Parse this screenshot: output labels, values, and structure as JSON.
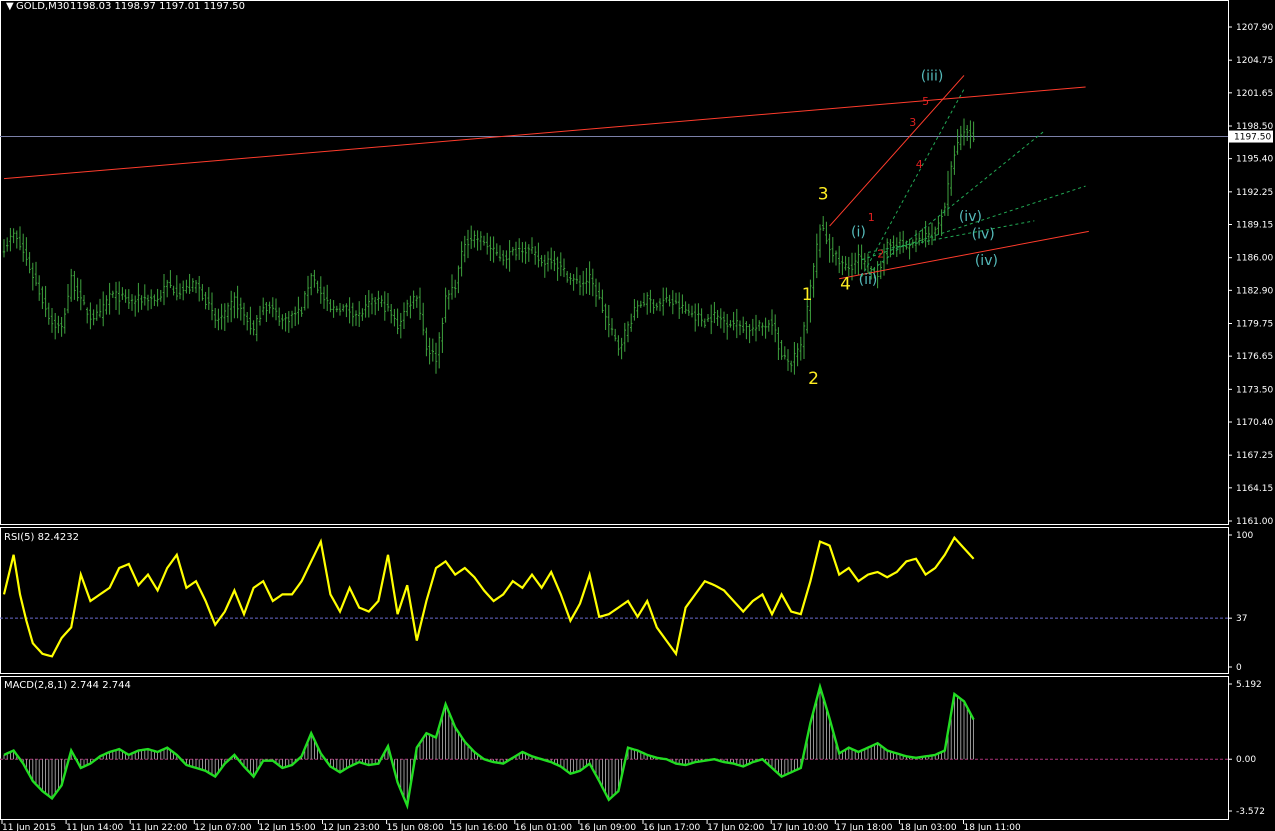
{
  "header": {
    "symbol": "GOLD,M30",
    "ohlc": "1198.03 1198.97 1197.01 1197.50",
    "rsi_label": "RSI(5) 82.4232",
    "macd_label": "MACD(2,8,1) 2.744 2.744"
  },
  "colors": {
    "background": "#000000",
    "candle": "#3fa33f",
    "rsi": "#ffff00",
    "macd": "#22dd22",
    "trendline": "#ff3c2c",
    "guide": "#22aa55",
    "price_line": "#7b80a8",
    "frame": "#ffffff"
  },
  "chart_data": [
    {
      "type": "candlestick",
      "name": "GOLD,M30",
      "ylim": [
        1160.0,
        1210.0
      ],
      "y_ticks": [
        "1207.90",
        "1204.75",
        "1201.65",
        "1198.50",
        "1195.40",
        "1192.25",
        "1189.15",
        "1186.00",
        "1182.90",
        "1179.75",
        "1176.65",
        "1173.50",
        "1170.40",
        "1167.25",
        "1164.15",
        "1161.00"
      ],
      "current_price": "1197.50",
      "x_ticks": [
        "11 Jun 2015",
        "11 Jun 14:00",
        "11 Jun 22:00",
        "12 Jun 07:00",
        "12 Jun 15:00",
        "12 Jun 23:00",
        "15 Jun 08:00",
        "15 Jun 16:00",
        "16 Jun 01:00",
        "16 Jun 09:00",
        "16 Jun 17:00",
        "17 Jun 02:00",
        "17 Jun 10:00",
        "17 Jun 18:00",
        "18 Jun 03:00",
        "18 Jun 11:00"
      ],
      "close_path": [
        [
          0,
          1187.0
        ],
        [
          3,
          1188.2
        ],
        [
          6,
          1186.5
        ],
        [
          9,
          1184.3
        ],
        [
          12,
          1182.0
        ],
        [
          15,
          1179.8
        ],
        [
          18,
          1179.3
        ],
        [
          21,
          1184.0
        ],
        [
          24,
          1181.8
        ],
        [
          27,
          1180.4
        ],
        [
          30,
          1180.5
        ],
        [
          33,
          1182.5
        ],
        [
          36,
          1182.3
        ],
        [
          39,
          1181.8
        ],
        [
          42,
          1182.0
        ],
        [
          45,
          1182.2
        ],
        [
          48,
          1182.0
        ],
        [
          51,
          1183.5
        ],
        [
          54,
          1182.8
        ],
        [
          57,
          1183.0
        ],
        [
          60,
          1183.5
        ],
        [
          63,
          1182.0
        ],
        [
          66,
          1180.0
        ],
        [
          69,
          1180.5
        ],
        [
          72,
          1182.0
        ],
        [
          75,
          1180.5
        ],
        [
          78,
          1179.0
        ],
        [
          81,
          1181.5
        ],
        [
          84,
          1181.0
        ],
        [
          87,
          1180.0
        ],
        [
          90,
          1180.5
        ],
        [
          93,
          1181.0
        ],
        [
          96,
          1184.5
        ],
        [
          99,
          1182.5
        ],
        [
          102,
          1181.0
        ],
        [
          105,
          1181.3
        ],
        [
          108,
          1181.0
        ],
        [
          111,
          1180.5
        ],
        [
          114,
          1181.5
        ],
        [
          117,
          1182.0
        ],
        [
          120,
          1181.0
        ],
        [
          123,
          1179.5
        ],
        [
          126,
          1181.5
        ],
        [
          129,
          1182.5
        ],
        [
          132,
          1177.5
        ],
        [
          135,
          1176.5
        ],
        [
          138,
          1182.0
        ],
        [
          141,
          1183.5
        ],
        [
          144,
          1187.5
        ],
        [
          147,
          1188.0
        ],
        [
          150,
          1187.5
        ],
        [
          153,
          1186.5
        ],
        [
          156,
          1186.0
        ],
        [
          159,
          1186.5
        ],
        [
          162,
          1187.0
        ],
        [
          165,
          1186.5
        ],
        [
          168,
          1185.5
        ],
        [
          171,
          1186.0
        ],
        [
          174,
          1185.0
        ],
        [
          177,
          1184.0
        ],
        [
          180,
          1183.5
        ],
        [
          183,
          1184.0
        ],
        [
          186,
          1182.0
        ],
        [
          189,
          1179.5
        ],
        [
          192,
          1177.5
        ],
        [
          195,
          1179.5
        ],
        [
          198,
          1181.5
        ],
        [
          201,
          1182.0
        ],
        [
          204,
          1181.5
        ],
        [
          207,
          1182.0
        ],
        [
          210,
          1181.5
        ],
        [
          213,
          1181.0
        ],
        [
          216,
          1180.5
        ],
        [
          219,
          1180.0
        ],
        [
          222,
          1180.5
        ],
        [
          225,
          1180.0
        ],
        [
          228,
          1179.8
        ],
        [
          231,
          1179.5
        ],
        [
          234,
          1179.2
        ],
        [
          237,
          1179.5
        ],
        [
          240,
          1180.0
        ],
        [
          243,
          1176.5
        ],
        [
          246,
          1176.0
        ],
        [
          249,
          1177.5
        ],
        [
          252,
          1183.0
        ],
        [
          255,
          1189.0
        ],
        [
          258,
          1187.0
        ],
        [
          261,
          1185.5
        ],
        [
          264,
          1185.0
        ],
        [
          267,
          1186.0
        ],
        [
          270,
          1185.0
        ],
        [
          273,
          1184.5
        ],
        [
          276,
          1187.0
        ],
        [
          279,
          1187.5
        ],
        [
          282,
          1187.0
        ],
        [
          285,
          1187.5
        ],
        [
          288,
          1188.0
        ],
        [
          291,
          1188.5
        ],
        [
          294,
          1191.0
        ],
        [
          297,
          1196.0
        ],
        [
          300,
          1198.0
        ],
        [
          303,
          1197.5
        ]
      ]
    },
    {
      "type": "line",
      "name": "RSI(5)",
      "ylim": [
        0,
        100
      ],
      "y_ticks": [
        "100",
        "37",
        "0"
      ],
      "level": 37,
      "points": [
        [
          0,
          55
        ],
        [
          3,
          85
        ],
        [
          5,
          55
        ],
        [
          7,
          35
        ],
        [
          9,
          18
        ],
        [
          12,
          10
        ],
        [
          15,
          8
        ],
        [
          18,
          22
        ],
        [
          21,
          30
        ],
        [
          24,
          70
        ],
        [
          27,
          50
        ],
        [
          30,
          55
        ],
        [
          33,
          60
        ],
        [
          36,
          75
        ],
        [
          39,
          78
        ],
        [
          42,
          62
        ],
        [
          45,
          70
        ],
        [
          48,
          58
        ],
        [
          51,
          75
        ],
        [
          54,
          85
        ],
        [
          57,
          60
        ],
        [
          60,
          65
        ],
        [
          63,
          50
        ],
        [
          66,
          32
        ],
        [
          69,
          42
        ],
        [
          72,
          58
        ],
        [
          75,
          40
        ],
        [
          78,
          60
        ],
        [
          81,
          65
        ],
        [
          84,
          50
        ],
        [
          87,
          55
        ],
        [
          90,
          55
        ],
        [
          93,
          65
        ],
        [
          96,
          80
        ],
        [
          99,
          95
        ],
        [
          102,
          55
        ],
        [
          105,
          42
        ],
        [
          108,
          60
        ],
        [
          111,
          45
        ],
        [
          114,
          42
        ],
        [
          117,
          50
        ],
        [
          120,
          85
        ],
        [
          123,
          40
        ],
        [
          126,
          62
        ],
        [
          129,
          20
        ],
        [
          132,
          50
        ],
        [
          135,
          75
        ],
        [
          138,
          80
        ],
        [
          141,
          70
        ],
        [
          144,
          75
        ],
        [
          147,
          68
        ],
        [
          150,
          58
        ],
        [
          153,
          50
        ],
        [
          156,
          55
        ],
        [
          159,
          65
        ],
        [
          162,
          60
        ],
        [
          165,
          70
        ],
        [
          168,
          60
        ],
        [
          171,
          72
        ],
        [
          174,
          55
        ],
        [
          177,
          35
        ],
        [
          180,
          48
        ],
        [
          183,
          70
        ],
        [
          186,
          38
        ],
        [
          189,
          40
        ],
        [
          192,
          45
        ],
        [
          195,
          50
        ],
        [
          198,
          38
        ],
        [
          201,
          50
        ],
        [
          204,
          30
        ],
        [
          207,
          20
        ],
        [
          210,
          10
        ],
        [
          213,
          45
        ],
        [
          216,
          55
        ],
        [
          219,
          65
        ],
        [
          222,
          62
        ],
        [
          225,
          58
        ],
        [
          228,
          50
        ],
        [
          231,
          42
        ],
        [
          234,
          50
        ],
        [
          237,
          55
        ],
        [
          240,
          40
        ],
        [
          243,
          55
        ],
        [
          246,
          42
        ],
        [
          249,
          40
        ],
        [
          252,
          65
        ],
        [
          255,
          95
        ],
        [
          258,
          92
        ],
        [
          261,
          70
        ],
        [
          264,
          75
        ],
        [
          267,
          65
        ],
        [
          270,
          70
        ],
        [
          273,
          72
        ],
        [
          276,
          68
        ],
        [
          279,
          72
        ],
        [
          282,
          80
        ],
        [
          285,
          82
        ],
        [
          288,
          70
        ],
        [
          291,
          75
        ],
        [
          294,
          85
        ],
        [
          297,
          98
        ],
        [
          300,
          90
        ],
        [
          303,
          82
        ]
      ]
    },
    {
      "type": "bar+line",
      "name": "MACD(2,8,1)",
      "ylim": [
        -3.572,
        5.192
      ],
      "y_ticks": [
        "5.192",
        "0.00",
        "-3.572"
      ],
      "points": [
        [
          0,
          0.3
        ],
        [
          3,
          0.6
        ],
        [
          6,
          -0.3
        ],
        [
          9,
          -1.5
        ],
        [
          12,
          -2.2
        ],
        [
          15,
          -2.7
        ],
        [
          18,
          -1.8
        ],
        [
          21,
          0.6
        ],
        [
          24,
          -0.6
        ],
        [
          27,
          -0.3
        ],
        [
          30,
          0.2
        ],
        [
          33,
          0.5
        ],
        [
          36,
          0.7
        ],
        [
          39,
          0.3
        ],
        [
          42,
          0.6
        ],
        [
          45,
          0.7
        ],
        [
          48,
          0.5
        ],
        [
          51,
          0.8
        ],
        [
          54,
          0.3
        ],
        [
          57,
          -0.4
        ],
        [
          60,
          -0.6
        ],
        [
          63,
          -0.8
        ],
        [
          66,
          -1.2
        ],
        [
          69,
          -0.3
        ],
        [
          72,
          0.3
        ],
        [
          75,
          -0.5
        ],
        [
          78,
          -1.2
        ],
        [
          81,
          -0.1
        ],
        [
          84,
          -0.1
        ],
        [
          87,
          -0.6
        ],
        [
          90,
          -0.4
        ],
        [
          93,
          0.2
        ],
        [
          96,
          1.8
        ],
        [
          99,
          0.4
        ],
        [
          102,
          -0.5
        ],
        [
          105,
          -0.9
        ],
        [
          108,
          -0.5
        ],
        [
          111,
          -0.2
        ],
        [
          114,
          -0.4
        ],
        [
          117,
          -0.3
        ],
        [
          120,
          0.9
        ],
        [
          123,
          -1.6
        ],
        [
          126,
          -3.2
        ],
        [
          129,
          0.8
        ],
        [
          132,
          1.8
        ],
        [
          135,
          1.5
        ],
        [
          138,
          3.8
        ],
        [
          141,
          2.2
        ],
        [
          144,
          1.2
        ],
        [
          147,
          0.5
        ],
        [
          150,
          0.0
        ],
        [
          153,
          -0.2
        ],
        [
          156,
          -0.3
        ],
        [
          159,
          0.1
        ],
        [
          162,
          0.5
        ],
        [
          165,
          0.2
        ],
        [
          168,
          0.0
        ],
        [
          171,
          -0.2
        ],
        [
          174,
          -0.5
        ],
        [
          177,
          -1.0
        ],
        [
          180,
          -0.8
        ],
        [
          183,
          -0.3
        ],
        [
          186,
          -1.5
        ],
        [
          189,
          -2.8
        ],
        [
          192,
          -2.2
        ],
        [
          195,
          0.8
        ],
        [
          198,
          0.6
        ],
        [
          201,
          0.3
        ],
        [
          204,
          0.1
        ],
        [
          207,
          0.0
        ],
        [
          210,
          -0.3
        ],
        [
          213,
          -0.4
        ],
        [
          216,
          -0.2
        ],
        [
          219,
          -0.1
        ],
        [
          222,
          0.0
        ],
        [
          225,
          -0.2
        ],
        [
          228,
          -0.3
        ],
        [
          231,
          -0.5
        ],
        [
          234,
          -0.2
        ],
        [
          237,
          0.0
        ],
        [
          240,
          -0.6
        ],
        [
          243,
          -1.2
        ],
        [
          246,
          -0.9
        ],
        [
          249,
          -0.6
        ],
        [
          252,
          2.5
        ],
        [
          255,
          5.0
        ],
        [
          258,
          2.8
        ],
        [
          261,
          0.4
        ],
        [
          264,
          0.8
        ],
        [
          267,
          0.5
        ],
        [
          270,
          0.8
        ],
        [
          273,
          1.1
        ],
        [
          276,
          0.6
        ],
        [
          279,
          0.4
        ],
        [
          282,
          0.2
        ],
        [
          285,
          0.1
        ],
        [
          288,
          0.2
        ],
        [
          291,
          0.3
        ],
        [
          294,
          0.6
        ],
        [
          297,
          4.5
        ],
        [
          300,
          4.0
        ],
        [
          303,
          2.744
        ]
      ]
    }
  ],
  "annotations": {
    "yellow": [
      {
        "text": "1",
        "i": 251,
        "y": 1182.0
      },
      {
        "text": "2",
        "i": 253,
        "y": 1174.0
      },
      {
        "text": "3",
        "i": 256,
        "y": 1191.5
      },
      {
        "text": "4",
        "i": 263,
        "y": 1183.0
      }
    ],
    "cyan": [
      {
        "text": "(i)",
        "i": 267,
        "y": 1188.0
      },
      {
        "text": "(ii)",
        "i": 270,
        "y": 1183.5
      },
      {
        "text": "(iii)",
        "i": 290,
        "y": 1202.8
      },
      {
        "text": "(iv)",
        "i": 302,
        "y": 1189.5
      },
      {
        "text": "(iv)",
        "i": 306,
        "y": 1187.8
      },
      {
        "text": "(iv)",
        "i": 307,
        "y": 1185.3
      }
    ],
    "red": [
      {
        "text": "1",
        "i": 271,
        "y": 1189.5
      },
      {
        "text": "2",
        "i": 274,
        "y": 1186.0
      },
      {
        "text": "3",
        "i": 284,
        "y": 1198.5
      },
      {
        "text": "4",
        "i": 286,
        "y": 1194.5
      },
      {
        "text": "5",
        "i": 288,
        "y": 1200.5
      }
    ]
  },
  "lines": {
    "trend": [
      {
        "from": [
          0,
          1193.5
        ],
        "to": [
          338,
          1202.2
        ]
      },
      {
        "from": [
          258,
          1189.0
        ],
        "to": [
          300,
          1203.3
        ]
      },
      {
        "from": [
          261,
          1184.0
        ],
        "to": [
          339,
          1188.5
        ]
      }
    ],
    "guides": [
      {
        "from": [
          268,
          1184.2
        ],
        "to": [
          300,
          1202.0
        ]
      },
      {
        "from": [
          270,
          1184.5
        ],
        "to": [
          325,
          1198.0
        ]
      },
      {
        "from": [
          268,
          1185.8
        ],
        "to": [
          338,
          1192.8
        ]
      },
      {
        "from": [
          270,
          1186.5
        ],
        "to": [
          322,
          1189.5
        ]
      }
    ]
  }
}
